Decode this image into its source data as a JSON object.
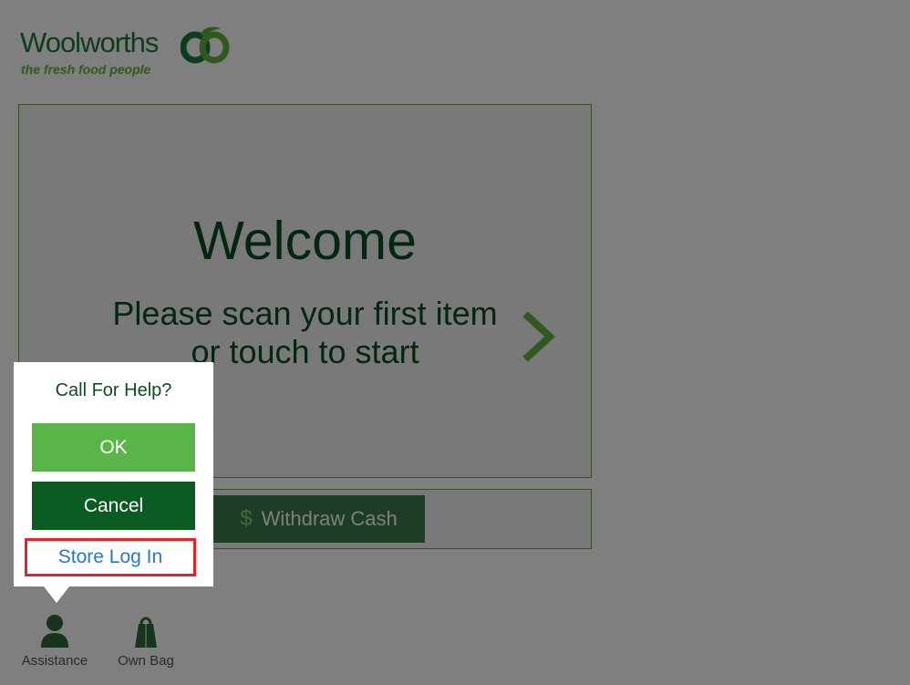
{
  "brand": {
    "name": "Woolworths",
    "tagline": "the fresh food people",
    "logo_icon": "woolworths-logo-mark",
    "green": "#1c7a3a",
    "light_green": "#63b33f"
  },
  "welcome": {
    "title": "Welcome",
    "line1": "Please scan your first item",
    "line2": "or touch to start",
    "arrow_icon": "chevron-right-icon"
  },
  "cash": {
    "currency_symbol": "$",
    "withdraw_label": "Withdraw Cash"
  },
  "footer": {
    "assistance_label": "Assistance",
    "assistance_icon": "person-icon",
    "own_bag_label": "Own Bag",
    "own_bag_icon": "bag-icon"
  },
  "help_popup": {
    "title": "Call For Help?",
    "ok_label": "OK",
    "cancel_label": "Cancel",
    "store_login_label": "Store Log In",
    "highlight_color": "#e1232c"
  }
}
